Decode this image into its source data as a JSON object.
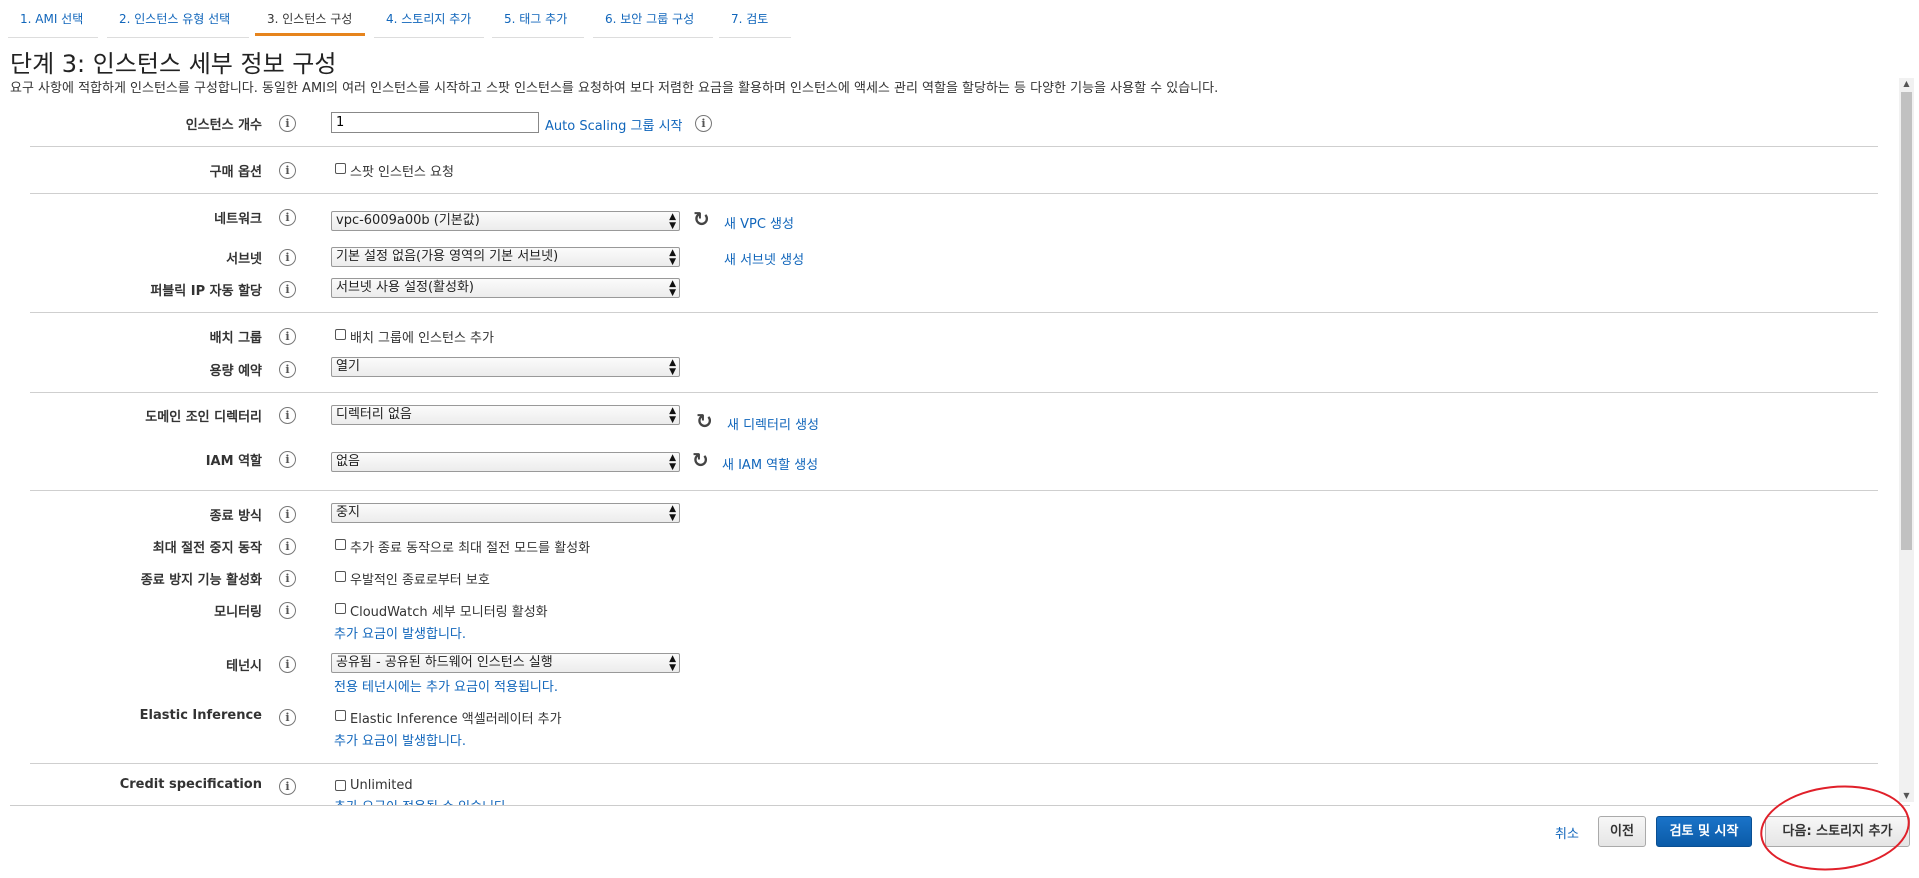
{
  "tabs": [
    {
      "label": "1. AMI 선택"
    },
    {
      "label": "2. 인스턴스 유형 선택"
    },
    {
      "label": "3. 인스턴스 구성"
    },
    {
      "label": "4. 스토리지 추가"
    },
    {
      "label": "5. 태그 추가"
    },
    {
      "label": "6. 보안 그룹 구성"
    },
    {
      "label": "7. 검토"
    }
  ],
  "page": {
    "title": "단계 3: 인스턴스 세부 정보 구성",
    "description": "요구 사항에 적합하게 인스턴스를 구성합니다. 동일한 AMI의 여러 인스턴스를 시작하고 스팟 인스턴스를 요청하여 보다 저렴한 요금을 활용하며 인스턴스에 액세스 관리 역할을 할당하는 등 다양한 기능을 사용할 수 있습니다."
  },
  "form": {
    "instance_count": {
      "label": "인스턴스 개수",
      "value": "1",
      "link": "Auto Scaling 그룹 시작"
    },
    "purchase_option": {
      "label": "구매 옵션",
      "checkbox": "스팟 인스턴스 요청"
    },
    "network": {
      "label": "네트워크",
      "value": "vpc-6009a00b (기본값)",
      "link": "새 VPC 생성"
    },
    "subnet": {
      "label": "서브넷",
      "value": "기본 설정 없음(가용 영역의 기본 서브넷)",
      "link": "새 서브넷 생성"
    },
    "public_ip": {
      "label": "퍼블릭 IP 자동 할당",
      "value": "서브넷 사용 설정(활성화)"
    },
    "placement_group": {
      "label": "배치 그룹",
      "checkbox": "배치 그룹에 인스턴스 추가"
    },
    "capacity_reservation": {
      "label": "용량 예약",
      "value": "열기"
    },
    "domain_join": {
      "label": "도메인 조인 디렉터리",
      "value": "디렉터리 없음",
      "link": "새 디렉터리 생성"
    },
    "iam_role": {
      "label": "IAM 역할",
      "value": "없음",
      "link": "새 IAM 역할 생성"
    },
    "shutdown_behavior": {
      "label": "종료 방식",
      "value": "중지"
    },
    "stop_hibernate": {
      "label": "최대 절전 중지 동작",
      "checkbox": "추가 종료 동작으로 최대 절전 모드를 활성화"
    },
    "termination_protection": {
      "label": "종료 방지 기능 활성화",
      "checkbox": "우발적인 종료로부터 보호"
    },
    "monitoring": {
      "label": "모니터링",
      "checkbox": "CloudWatch 세부 모니터링 활성화",
      "note": "추가 요금이 발생합니다."
    },
    "tenancy": {
      "label": "테넌시",
      "value": "공유됨 - 공유된 하드웨어 인스턴스 실행",
      "note": "전용 테넌시에는 추가 요금이 적용됩니다."
    },
    "elastic_inference": {
      "label": "Elastic Inference",
      "checkbox": "Elastic Inference 액셀러레이터 추가",
      "note": "추가 요금이 발생합니다."
    },
    "credit_spec": {
      "label": "Credit specification",
      "checkbox": "Unlimited",
      "note": "추가 요금이 적용될 수 있습니다"
    }
  },
  "footer": {
    "cancel": "취소",
    "previous": "이전",
    "review_launch": "검토 및 시작",
    "next": "다음: 스토리지 추가"
  },
  "icons": {
    "info": "info-icon",
    "refresh": "refresh-icon"
  },
  "colors": {
    "link": "#1166bb",
    "primary_button": "#0b5ba8",
    "active_tab_underline": "#e6841d",
    "annotation_circle": "#e0202a"
  }
}
